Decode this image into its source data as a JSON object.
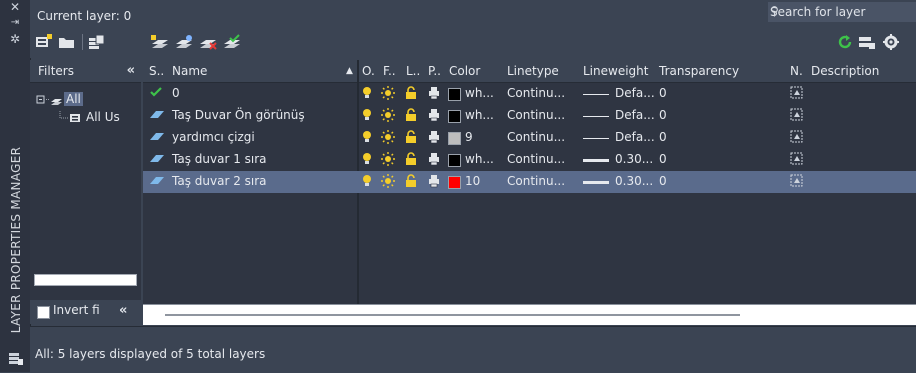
{
  "palette": {
    "panel_bg": "#3b4453",
    "grid_bg": "#2f3542",
    "selected_row": "#5a6b8c",
    "accent_green": "#3ec24a",
    "yellow": "#f4cd2a"
  },
  "window": {
    "side_title": "LAYER PROPERTIES MANAGER",
    "close_icon": "x-icon",
    "autohide_icon": "pin-icon",
    "properties_icon": "gear-icon"
  },
  "header": {
    "current_layer": "Current layer: 0",
    "search_placeholder": "Search for layer"
  },
  "toolbar": {
    "icons": [
      "new-property-filter-icon",
      "new-group-filter-icon",
      "layer-states-manager-icon",
      "new-layer-icon",
      "new-layer-vp-frozen-icon",
      "delete-layer-icon",
      "set-current-icon",
      "refresh-icon",
      "settings-icon"
    ]
  },
  "filters": {
    "header": "Filters",
    "collapse": "«",
    "tree": [
      {
        "label": "All",
        "selected": true
      },
      {
        "label": "All Us"
      }
    ],
    "invert_label": "Invert fi",
    "invert_collapse": "«"
  },
  "grid": {
    "columns": {
      "status": "S..",
      "name": "Name",
      "on": "O.",
      "freeze": "F..",
      "lock": "L..",
      "plot": "P..",
      "color": "Color",
      "linetype": "Linetype",
      "lineweight": "Lineweight",
      "transparency": "Transparency",
      "new_vp_freeze": "N.",
      "description": "Description"
    },
    "rows": [
      {
        "status": "current",
        "name": "0",
        "color_hex": "#000000",
        "color": "wh...",
        "linetype": "Continu...",
        "lineweight": "Defa...",
        "lineweight_style": "thin",
        "transparency": "0",
        "selected": false
      },
      {
        "status": "layer",
        "name": "Taş Duvar Ön görünüş",
        "color_hex": "#000000",
        "color": "wh...",
        "linetype": "Continu...",
        "lineweight": "Defa...",
        "lineweight_style": "thin",
        "transparency": "0",
        "selected": false
      },
      {
        "status": "layer",
        "name": "yardımcı çizgi",
        "color_hex": "#bdbdbd",
        "color": "9",
        "linetype": "Continu...",
        "lineweight": "Defa...",
        "lineweight_style": "thin",
        "transparency": "0",
        "selected": false
      },
      {
        "status": "layer",
        "name": "Taş duvar 1 sıra",
        "color_hex": "#000000",
        "color": "wh...",
        "linetype": "Continu...",
        "lineweight": "0.30...",
        "lineweight_style": "thick",
        "transparency": "0",
        "selected": false
      },
      {
        "status": "layer",
        "name": "Taş duvar 2 sıra",
        "color_hex": "#ff0000",
        "color": "10",
        "linetype": "Continu...",
        "lineweight": "0.30...",
        "lineweight_style": "thick",
        "transparency": "0",
        "selected": true
      }
    ]
  },
  "status_bar": {
    "text": "All: 5 layers displayed of 5 total layers"
  }
}
